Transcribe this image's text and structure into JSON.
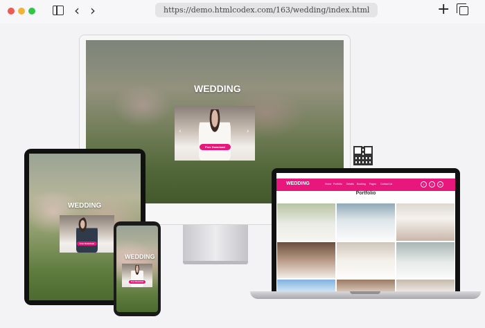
{
  "browser": {
    "url": "https://demo.htmlcodex.com/163/wedding/index.html",
    "back_icon": "‹",
    "forward_icon": "›",
    "new_tab_icon": "+"
  },
  "site": {
    "hero_title": "WEDDING",
    "download_label": "Free Download",
    "section_title": "Portfolio",
    "nav_brand": "WEDDING",
    "nav_items": [
      "Home",
      "Portfolio",
      "Details",
      "Booking",
      "Pages",
      "Contact Us"
    ]
  },
  "colors": {
    "accent": "#e8177c"
  }
}
